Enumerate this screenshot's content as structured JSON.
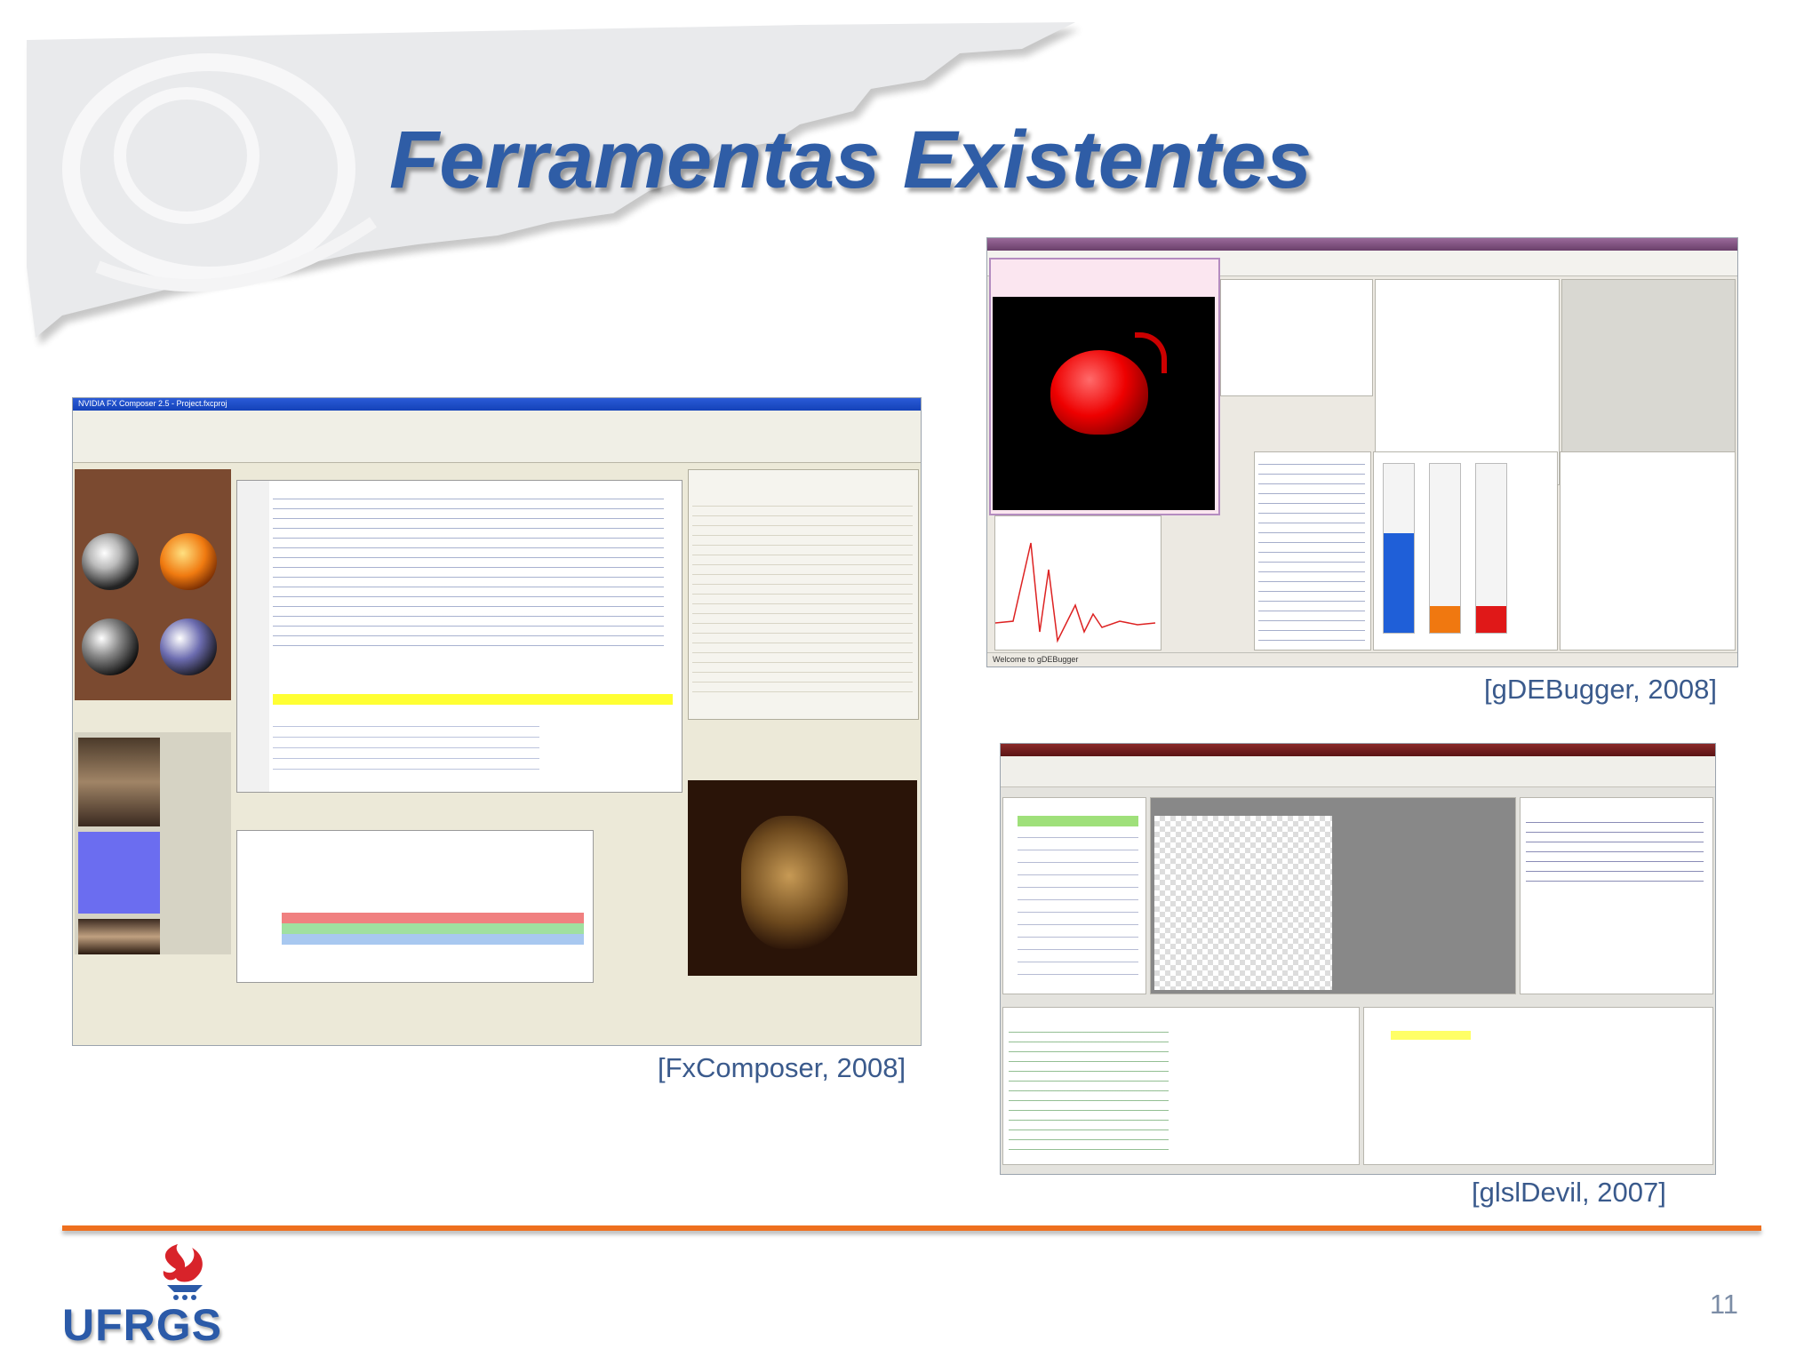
{
  "slide": {
    "title": "Ferramentas Existentes",
    "page_number": "11",
    "logo_text": "UFRGS"
  },
  "images": [
    {
      "name": "fxcomposer",
      "caption": "[FxComposer, 2008]",
      "window_title": "NVIDIA FX Composer 2.5 - Project.fxcproj"
    },
    {
      "name": "gdebugger",
      "caption": "[gDEBugger, 2008]",
      "status_text": "Welcome to gDEBugger"
    },
    {
      "name": "glsldevil",
      "caption": "[glslDevil, 2007]"
    }
  ],
  "colors": {
    "title": "#2f5da6",
    "rule": "#ee6f1e",
    "caption": "#3a5a8c",
    "logo_flame": "#d8232a",
    "logo_text": "#2b5aa8"
  }
}
